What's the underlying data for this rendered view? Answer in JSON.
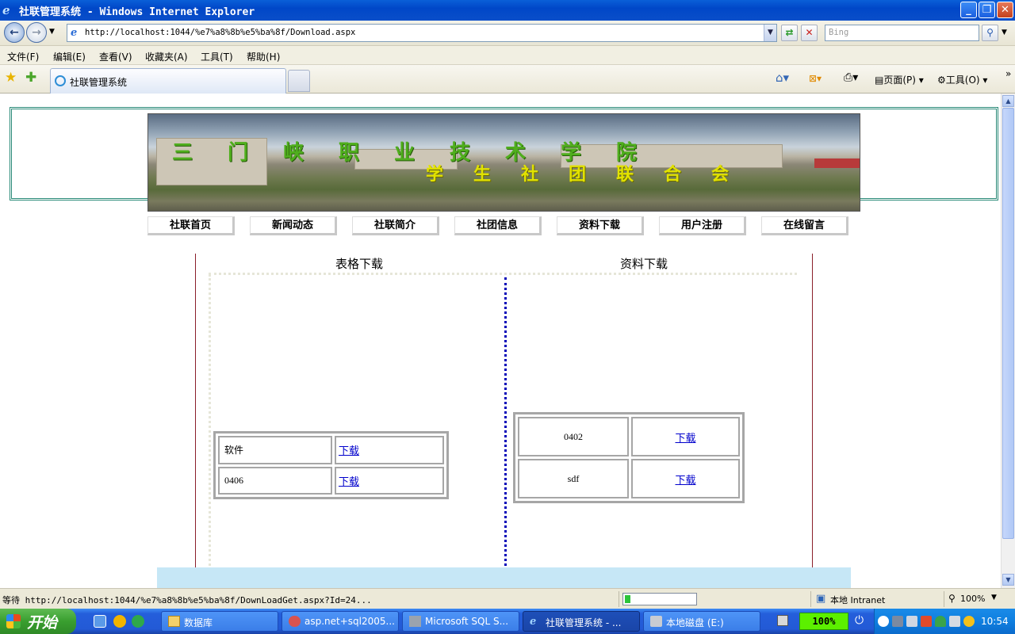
{
  "window": {
    "title": "社联管理系统 - Windows Internet Explorer"
  },
  "addressbar": {
    "url": "http://localhost:1044/%e7%a8%8b%e5%ba%8f/Download.aspx",
    "search_placeholder": "Bing"
  },
  "menu": [
    "文件(F)",
    "编辑(E)",
    "查看(V)",
    "收藏夹(A)",
    "工具(T)",
    "帮助(H)"
  ],
  "tabs": {
    "active_label": "社联管理系统"
  },
  "commandbar": {
    "page_label": "页面(P)",
    "tools_label": "工具(O)"
  },
  "site": {
    "banner_line1": "三门峡职业技术学院",
    "banner_line2": "学生社团联合会",
    "nav": [
      "社联首页",
      "新闻动态",
      "社联简介",
      "社团信息",
      "资料下载",
      "用户注册",
      "在线留言"
    ]
  },
  "downloads": {
    "forms_title": "表格下载",
    "materials_title": "资料下载",
    "forms": [
      {
        "name": "软件",
        "link": "下载"
      },
      {
        "name": "0406",
        "link": "下载"
      }
    ],
    "materials": [
      {
        "name": "0402",
        "link": "下载"
      },
      {
        "name": "sdf",
        "link": "下载"
      }
    ]
  },
  "status": {
    "text": "等待 http://localhost:1044/%e7%a8%8b%e5%ba%8f/DownLoadGet.aspx?Id=24...",
    "zone": "本地 Intranet",
    "zoom": "100%",
    "progress": 0.08
  },
  "taskbar": {
    "start_label": "开始",
    "tasks": [
      "数据库",
      "asp.net+sql2005...",
      "Microsoft SQL S...",
      "社联管理系统 - ...",
      "本地磁盘 (E:)"
    ],
    "battery_pct": "100%",
    "clock": "10:54"
  },
  "colors": {
    "header_border": "#2a8a78",
    "divider": "#0000b8",
    "footer": "#c6e7f6"
  }
}
